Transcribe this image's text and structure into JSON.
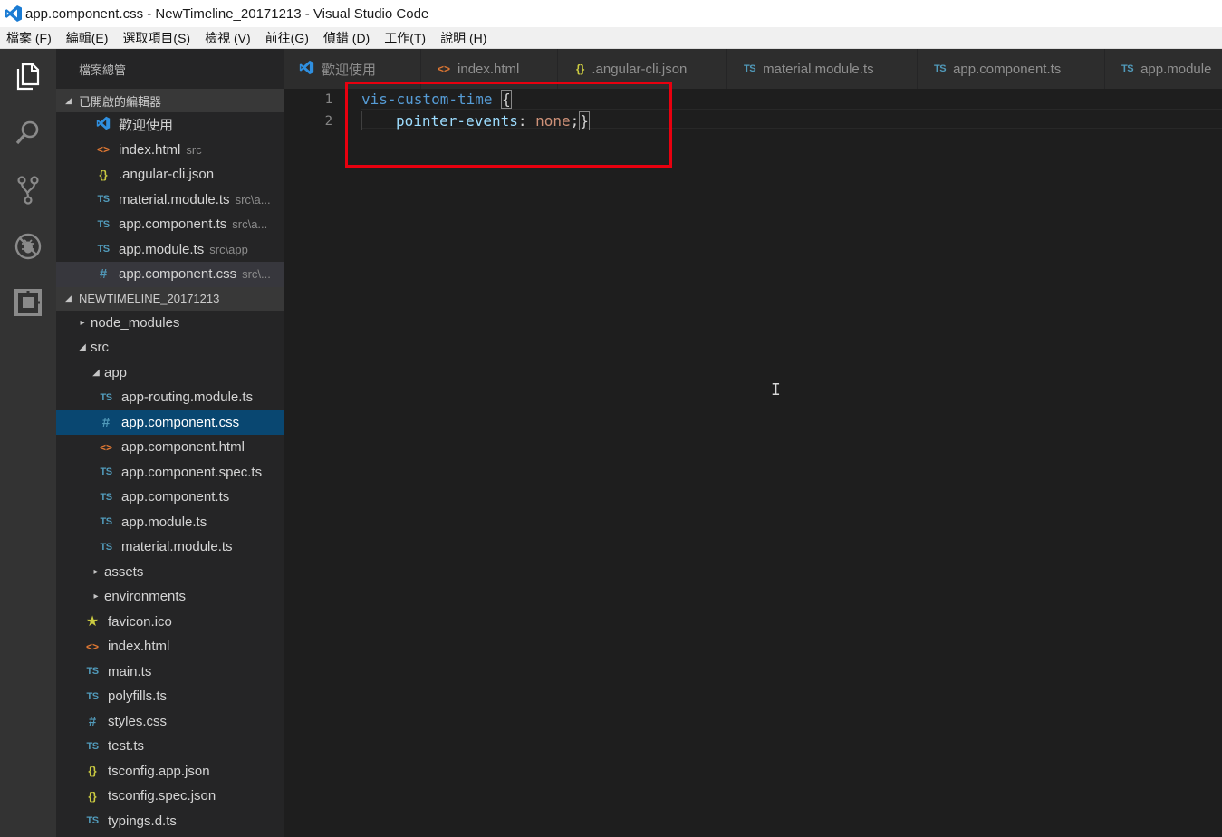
{
  "window": {
    "title": "app.component.css - NewTimeline_20171213 - Visual Studio Code"
  },
  "menu": [
    "檔案 (F)",
    "編輯(E)",
    "選取項目(S)",
    "檢視 (V)",
    "前往(G)",
    "偵錯 (D)",
    "工作(T)",
    "說明 (H)"
  ],
  "activity": [
    "explorer-icon",
    "search-icon",
    "source-control-icon",
    "debug-icon",
    "extensions-icon"
  ],
  "sidebar": {
    "title": "檔案總管",
    "open_editors": {
      "label": "已開啟的編輯器",
      "items": [
        {
          "name": "歡迎使用",
          "desc": "",
          "icon": "vscode-icon"
        },
        {
          "name": "index.html",
          "desc": "src",
          "icon": "<>"
        },
        {
          "name": ".angular-cli.json",
          "desc": "",
          "icon": "{}"
        },
        {
          "name": "material.module.ts",
          "desc": "src\\a...",
          "icon": "TS"
        },
        {
          "name": "app.component.ts",
          "desc": "src\\a...",
          "icon": "TS"
        },
        {
          "name": "app.module.ts",
          "desc": "src\\app",
          "icon": "TS"
        },
        {
          "name": "app.component.css",
          "desc": "src\\...",
          "icon": "#"
        }
      ]
    },
    "project": {
      "label": "NEWTIMELINE_20171213",
      "node_modules": "node_modules",
      "src": "src",
      "app": "app",
      "app_files": [
        {
          "name": "app-routing.module.ts",
          "icon": "TS"
        },
        {
          "name": "app.component.css",
          "icon": "#"
        },
        {
          "name": "app.component.html",
          "icon": "<>"
        },
        {
          "name": "app.component.spec.ts",
          "icon": "TS"
        },
        {
          "name": "app.component.ts",
          "icon": "TS"
        },
        {
          "name": "app.module.ts",
          "icon": "TS"
        },
        {
          "name": "material.module.ts",
          "icon": "TS"
        }
      ],
      "assets": "assets",
      "environments": "environments",
      "src_files": [
        {
          "name": "favicon.ico",
          "icon": "★"
        },
        {
          "name": "index.html",
          "icon": "<>"
        },
        {
          "name": "main.ts",
          "icon": "TS"
        },
        {
          "name": "polyfills.ts",
          "icon": "TS"
        },
        {
          "name": "styles.css",
          "icon": "#"
        },
        {
          "name": "test.ts",
          "icon": "TS"
        },
        {
          "name": "tsconfig.app.json",
          "icon": "{}"
        },
        {
          "name": "tsconfig.spec.json",
          "icon": "{}"
        },
        {
          "name": "typings.d.ts",
          "icon": "TS"
        }
      ]
    }
  },
  "tabs": [
    {
      "label": "歡迎使用",
      "icon": "vscode-icon"
    },
    {
      "label": "index.html",
      "icon": "<>"
    },
    {
      "label": ".angular-cli.json",
      "icon": "{}"
    },
    {
      "label": "material.module.ts",
      "icon": "TS"
    },
    {
      "label": "app.component.ts",
      "icon": "TS"
    },
    {
      "label": "app.module",
      "icon": "TS"
    }
  ],
  "editor": {
    "line_numbers": [
      "1",
      "2"
    ],
    "line1_selector": "vis-custom-time",
    "line1_brace": "{",
    "line2_prop": "pointer-events",
    "line2_colon": ": ",
    "line2_value": "none",
    "line2_semicolon": ";",
    "line2_brace": "}"
  },
  "colors": {
    "highlight_box": "#e8000f",
    "selected_row": "#094771",
    "ts_icon": "#519aba",
    "html_icon": "#e37933",
    "json_icon": "#cbcb41"
  }
}
